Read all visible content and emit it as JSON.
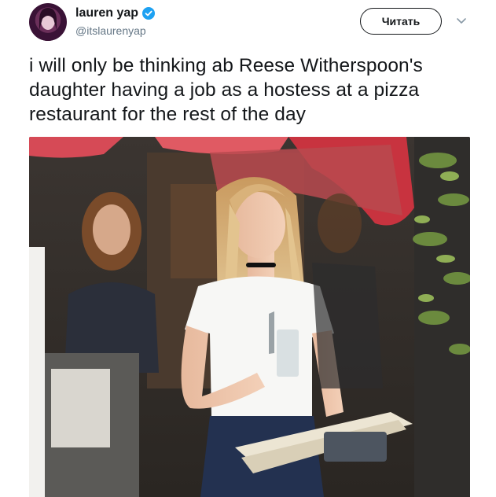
{
  "tweet": {
    "display_name": "lauren yap",
    "handle": "@itslaurenyap",
    "follow_label": "Читать",
    "text": "i will only be thinking ab Reese Witherspoon's daughter having a job as a hostess at a pizza restaurant for the rest of the day"
  },
  "icons": {
    "verified": "verified-badge-icon",
    "menu": "chevron-down-icon"
  },
  "colors": {
    "verified_blue": "#1da1f2",
    "handle_gray": "#657786",
    "text": "#14171a"
  }
}
